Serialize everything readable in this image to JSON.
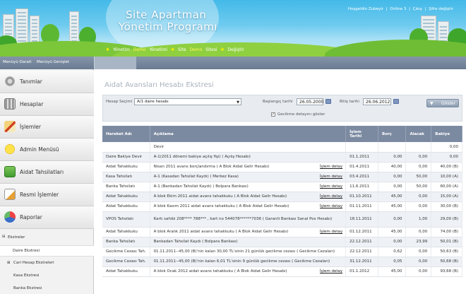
{
  "header": {
    "logo_line1": "Site Apartman",
    "logo_line2": "Yönetim Programı",
    "welcome": "Hoşgeldin Zubeyir",
    "online": "Online 3",
    "logout": "Çıkış",
    "change_password": "Şifre değiştir",
    "nav": [
      "Yönetim",
      "Demo",
      "Yönetimi",
      "Site",
      "Demo",
      "Sitesi",
      "Değiştir"
    ]
  },
  "menubar": {
    "collapse": "Menüyü Daralt",
    "expand": "Menüyü Genişlet"
  },
  "sidebar": {
    "items": [
      {
        "label": "Tanımlar",
        "icon": "gear-icon"
      },
      {
        "label": "Hesaplar",
        "icon": "calculator-icon"
      },
      {
        "label": "İşlemler",
        "icon": "pencil-icon"
      },
      {
        "label": "Admin Menüsü",
        "icon": "smiley-icon"
      },
      {
        "label": "Aidat Tahsilatları",
        "icon": "money-icon"
      },
      {
        "label": "Resmi İşlemler",
        "icon": "document-icon"
      },
      {
        "label": "Raporlar",
        "icon": "chart-icon"
      }
    ],
    "section": "Ekstreler",
    "subitems": [
      "Daire Ekstresi",
      "Cari Hesap Ekstreleri",
      "Kasa Ekstresi",
      "Banka Ekstresi"
    ]
  },
  "main": {
    "title": "Aidat Avansları Hesabı Ekstresi",
    "filter": {
      "account_label": "Hesap Seçimi",
      "account_value": "A/1 daire hesabı",
      "start_label": "Başlangıç tarihi",
      "start_value": "26.05.2000",
      "end_label": "Bitiş tarihi",
      "end_value": "26.06.2012",
      "show_label": "Göster",
      "late_fee_label": "Gecikme detayını göster"
    },
    "table": {
      "headers": [
        "Hareket Adı",
        "Açıklama",
        "İşlem Tarihi",
        "Borç",
        "Alacak",
        "Bakiye"
      ],
      "rows": [
        {
          "type": "",
          "desc": "Devir",
          "detail": "",
          "date": "",
          "debit": "",
          "credit": "",
          "balance": "0,00",
          "bal_class": ""
        },
        {
          "type": "Daire Bakiye Devir",
          "desc": "A-1(2011 dönemi bakiye açılış fişi) ( Açılış Hesabı)",
          "detail": "",
          "date": "01.1.2011",
          "debit": "0,00",
          "credit": "0,00",
          "balance": "0,00",
          "bal_class": ""
        },
        {
          "type": "Aidat Tahakkuku",
          "desc": "Nisan 2011 avans borçlandırma ( A Blok Aidat Gelir Hesabı)",
          "detail": "İşlem detay",
          "date": "01.4.2011",
          "debit": "40,00",
          "credit": "0,00",
          "balance": "40,00 (B)",
          "bal_class": "bal-red"
        },
        {
          "type": "Kasa Tahsilatı",
          "desc": "A-1 (Kasadan Tahsilat Kaydı) ( Merkez Kasa)",
          "detail": "İşlem detay",
          "date": "03.4.2011",
          "debit": "0,00",
          "credit": "50,00",
          "balance": "10,00 (A)",
          "bal_class": "bal-green"
        },
        {
          "type": "Banka Tahsilatı",
          "desc": "A-1 (Bankadan Tahsilat Kaydı) ( Bolpara Bankası)",
          "detail": "İşlem detay",
          "date": "11.6.2011",
          "debit": "0,00",
          "credit": "50,00",
          "balance": "60,00 (A)",
          "bal_class": "bal-green"
        },
        {
          "type": "Aidat Tahakkuku",
          "desc": "A blok Ekim 2011 aidat avans tahakkuku ( A Blok Aidat Gelir Hesabı)",
          "detail": "İşlem detay",
          "date": "01.10.2011",
          "debit": "45,00",
          "credit": "0,00",
          "balance": "15,00 (A)",
          "bal_class": "bal-green"
        },
        {
          "type": "Aidat Tahakkuku",
          "desc": "A blok Kasım 2011 aidat avans tahakkuku ( A Blok Aidat Gelir Hesabı)",
          "detail": "İşlem detay",
          "date": "01.11.2011",
          "debit": "45,00",
          "credit": "0,00",
          "balance": "30,00 (B)",
          "bal_class": "bal-red"
        },
        {
          "type": "VPOS Tahsilatı",
          "desc": "Kartı sahibi 208**** 788*** , kart no 544078******7036 ( Garanti Bankası Sanal Pos Hesabı)",
          "detail": "",
          "date": "18.11.2011",
          "debit": "0,00",
          "credit": "1,00",
          "balance": "29,00 (B)",
          "bal_class": "bal-red",
          "tall": true
        },
        {
          "type": "Aidat Tahakkuku",
          "desc": "A blok Aralık 2011 aidat avans tahakkuku ( A Blok Aidat Gelir Hesabı)",
          "detail": "İşlem detay",
          "date": "01.12.2011",
          "debit": "45,00",
          "credit": "0,00",
          "balance": "74,00 (B)",
          "bal_class": "bal-red"
        },
        {
          "type": "Banka Tahsilatı",
          "desc": "Bankadan Tahsilat Kaydı ( Bolpara Bankası)",
          "detail": "",
          "date": "22.12.2011",
          "debit": "0,00",
          "credit": "23,99",
          "balance": "50,01 (B)",
          "bal_class": "bal-red"
        },
        {
          "type": "Gecikme Cezası Tah.",
          "desc": "01.11.2011--45,00 (B)'nin kalan 30,00 TL'sinin 21 günlük gecikme cezası ( Gecikme Cezaları)",
          "detail": "",
          "date": "22.12.2011",
          "debit": "0,62",
          "credit": "0,00",
          "balance": "50,63 (B)",
          "bal_class": "bal-red"
        },
        {
          "type": "Gecikme Cezası Tah.",
          "desc": "01.11.2011--45,00 (B)'nin kalan 6,01 TL'sinin 9 günlük gecikme cezası ( Gecikme Cezaları)",
          "detail": "",
          "date": "31.12.2011",
          "debit": "0,05",
          "credit": "0,00",
          "balance": "50,68 (B)",
          "bal_class": "bal-red"
        },
        {
          "type": "Aidat Tahakkuku",
          "desc": "A blok Ocak 2012 aidat avans tahakkuku ( A Blok Aidat Gelir Hesabı)",
          "detail": "İşlem detay",
          "date": "01.1.2012",
          "debit": "45,00",
          "credit": "0,00",
          "balance": "93,68 (B)",
          "bal_class": "bal-red"
        }
      ]
    }
  },
  "colors": {
    "header_sky": "#43b9e8",
    "grey_bar": "#7687a0",
    "table_header": "#7c8aa1",
    "red": "#cc1a1a",
    "green": "#2a8c2a"
  }
}
